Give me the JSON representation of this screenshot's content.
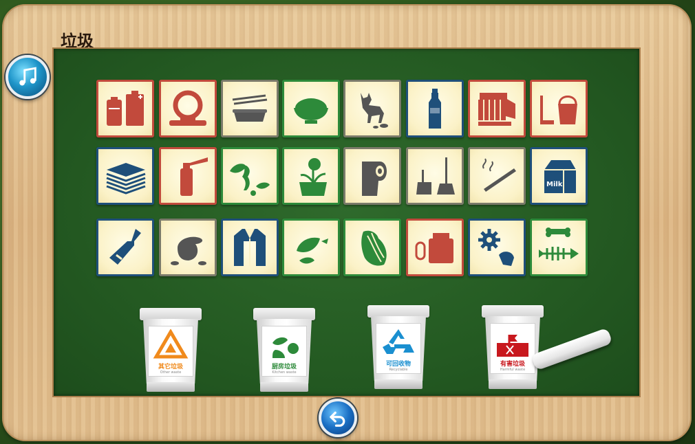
{
  "title": "垃圾",
  "colors": {
    "hazard_red": "#c24a3c",
    "recycle_blue": "#1e4f7a",
    "kitchen_green": "#2d8a3a",
    "other_orange": "#f08a1c"
  },
  "cards": [
    {
      "icon": "batteries-icon",
      "category": "hazard"
    },
    {
      "icon": "hose-reel-icon",
      "category": "hazard"
    },
    {
      "icon": "takeout-box-icon",
      "category": "other"
    },
    {
      "icon": "food-bowl-icon",
      "category": "kitchen"
    },
    {
      "icon": "dog-waste-icon",
      "category": "other"
    },
    {
      "icon": "plastic-bottle-icon",
      "category": "recyclable"
    },
    {
      "icon": "film-reel-icon",
      "category": "hazard"
    },
    {
      "icon": "paint-bucket-icon",
      "category": "hazard"
    },
    {
      "icon": "paper-stack-icon",
      "category": "recyclable"
    },
    {
      "icon": "spray-can-icon",
      "category": "hazard"
    },
    {
      "icon": "apple-core-icon",
      "category": "kitchen"
    },
    {
      "icon": "potted-plant-icon",
      "category": "kitchen"
    },
    {
      "icon": "toilet-paper-icon",
      "category": "other"
    },
    {
      "icon": "dustpan-broom-icon",
      "category": "other"
    },
    {
      "icon": "cigarette-icon",
      "category": "other"
    },
    {
      "icon": "milk-carton-icon",
      "category": "recyclable"
    },
    {
      "icon": "glass-bottle-icon",
      "category": "recyclable"
    },
    {
      "icon": "dirt-pile-icon",
      "category": "other"
    },
    {
      "icon": "coat-icon",
      "category": "recyclable"
    },
    {
      "icon": "leaves-icon",
      "category": "kitchen"
    },
    {
      "icon": "cabbage-icon",
      "category": "kitchen"
    },
    {
      "icon": "medicine-icon",
      "category": "hazard"
    },
    {
      "icon": "gear-bulb-icon",
      "category": "recyclable"
    },
    {
      "icon": "fish-bone-icon",
      "category": "kitchen"
    }
  ],
  "milk_text": "Milk",
  "bins": [
    {
      "label": "其它垃圾",
      "label_en": "Other waste",
      "color": "#f08a1c",
      "icon": "triangle-arrow-icon"
    },
    {
      "label": "厨房垃圾",
      "label_en": "Kitchen waste",
      "color": "#2d8a3a",
      "icon": "food-scraps-icon"
    },
    {
      "label": "可回收物",
      "label_en": "Recyclable",
      "color": "#1a8fd0",
      "icon": "recycle-icon"
    },
    {
      "label": "有害垃圾",
      "label_en": "Harmful waste",
      "color": "#c8181e",
      "icon": "hazard-icon"
    }
  ]
}
